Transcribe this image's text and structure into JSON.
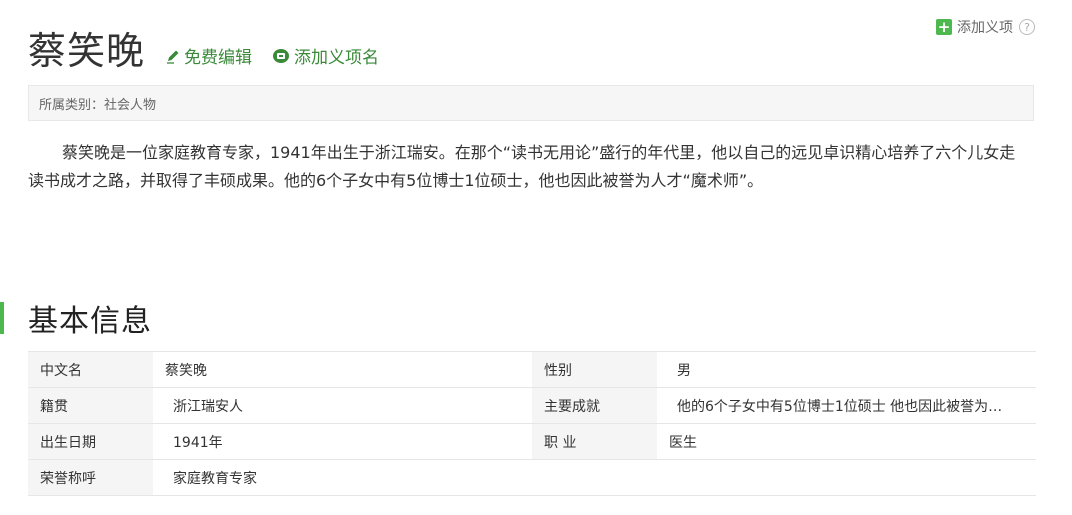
{
  "top_action": {
    "label": "添加义项",
    "help": "?"
  },
  "title": "蔡笑晚",
  "title_links": {
    "edit": "免费编辑",
    "add_name": "添加义项名"
  },
  "category": {
    "label": "所属类别：",
    "value": "社会人物"
  },
  "summary": "蔡笑晚是一位家庭教育专家，1941年出生于浙江瑞安。在那个“读书无用论”盛行的年代里，他以自己的远见卓识精心培养了六个儿女走读书成才之路，并取得了丰硕成果。他的6个子女中有5位博士1位硕士，他也因此被誉为人才“魔术师”。",
  "section_title": "基本信息",
  "info": {
    "rows": [
      {
        "left": {
          "label": "中文名",
          "value": "蔡笑晚"
        },
        "right": {
          "label": "性别",
          "value": "男"
        }
      },
      {
        "left": {
          "label": "籍贯",
          "value": "浙江瑞安人"
        },
        "right": {
          "label": "主要成就",
          "value": "他的6个子女中有5位博士1位硕士 他也因此被誉为…"
        }
      },
      {
        "left": {
          "label": "出生日期",
          "value": "1941年"
        },
        "right": {
          "label": "职  业",
          "value": "医生"
        }
      },
      {
        "left": {
          "label": "荣誉称呼",
          "value": "家庭教育专家"
        }
      }
    ]
  },
  "colors": {
    "accent_green": "#4db84d",
    "link_green": "#3a8a3a",
    "label_bg": "#f5f5f5"
  }
}
